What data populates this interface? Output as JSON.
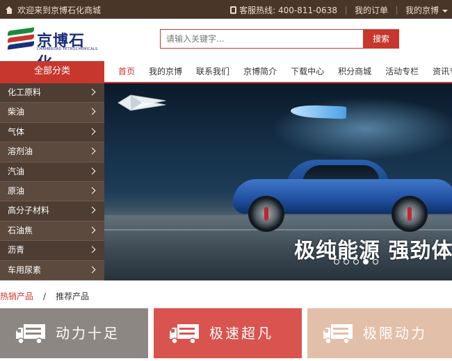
{
  "topbar": {
    "welcome": "欢迎来到京博石化商城",
    "hotline": "客服热线: 400-811-0638",
    "my_orders": "我的订单",
    "my_jingbo": "我的京博"
  },
  "logo": {
    "name": "京博石化",
    "subtitle": "CHAMBROAD PETROCHEMICALS",
    "colors": [
      "#c8372d",
      "#1b8a3f",
      "#1b2f7a"
    ]
  },
  "search": {
    "placeholder": "请输入关键字...",
    "button": "搜索"
  },
  "nav": {
    "all_categories": "全部分类",
    "links": [
      "首页",
      "我的京博",
      "联系我们",
      "京博简介",
      "下载中心",
      "积分商城",
      "活动专栏",
      "资讯专区"
    ]
  },
  "sidebar": {
    "items": [
      "化工原料",
      "柴油",
      "气体",
      "溶剂油",
      "汽油",
      "原油",
      "高分子材料",
      "石油焦",
      "沥青",
      "车用尿素"
    ]
  },
  "banner": {
    "slogan": "极纯能源 强劲体验",
    "slide_count": 5,
    "active_slide": 4
  },
  "tabs": {
    "hot": "热销产品",
    "recommended": "推荐产品"
  },
  "promos": [
    {
      "label": "动力十足",
      "color": "#8d8783"
    },
    {
      "label": "极速超凡",
      "color": "#d9534f"
    },
    {
      "label": "极限动力",
      "color": "#e2bfa9"
    }
  ],
  "colors": {
    "brand_red": "#c8372d",
    "topbar_brown": "#4a3628",
    "sidebar_brown": "#5c4a3e"
  }
}
